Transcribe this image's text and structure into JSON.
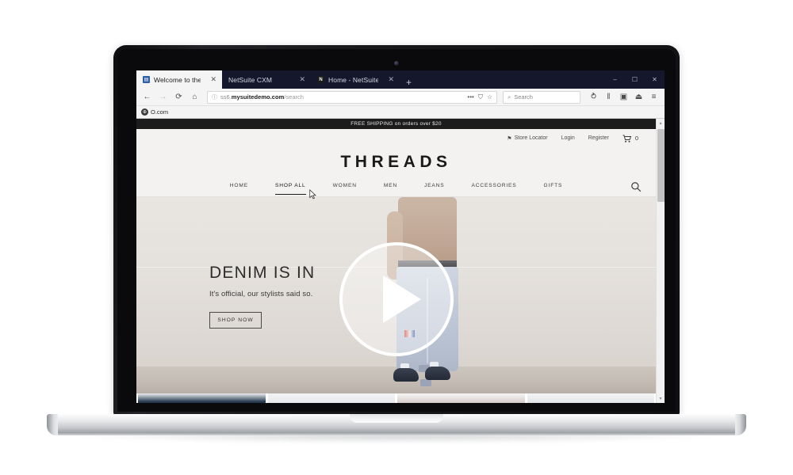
{
  "browser": {
    "tabs": [
      {
        "title": "Welcome to the store",
        "favicon": "store-favicon",
        "favicon_glyph": "▤",
        "active": true,
        "close": "✕"
      },
      {
        "title": "NetSuite CXM",
        "favicon": "netsuite-favicon",
        "favicon_glyph": "",
        "active": false,
        "close": "✕"
      },
      {
        "title": "Home - NetSuite (SuiteSucces",
        "favicon": "netsuite-favicon",
        "favicon_glyph": "N",
        "active": false,
        "close": "✕"
      }
    ],
    "new_tab_label": "+",
    "window_controls": {
      "minimize": "–",
      "maximize": "☐",
      "close": "✕"
    },
    "nav": {
      "back": "←",
      "forward": "→",
      "reload": "⟳",
      "home": "⌂"
    },
    "url": {
      "security_glyph": "ⓘ",
      "subdomain": "ss6.",
      "domain": "mysuitedemo.com",
      "path": "/search",
      "page_actions": "•••",
      "tracking_shield": "⛉",
      "bookmark_star": "☆"
    },
    "search": {
      "placeholder": "Search",
      "icon": "search-icon",
      "glyph": "⌕"
    },
    "toolbar_icons": [
      {
        "name": "pocket-icon",
        "glyph": "⥁"
      },
      {
        "name": "library-icon",
        "glyph": "‖"
      },
      {
        "name": "sidebar-icon",
        "glyph": "▣"
      },
      {
        "name": "save-page-icon",
        "glyph": "⏏"
      },
      {
        "name": "app-menu-icon",
        "glyph": "≡"
      }
    ],
    "bookmarks": [
      {
        "label": "O.com",
        "icon_glyph": "⊕"
      }
    ]
  },
  "site": {
    "promo_banner": "FREE SHIPPING on orders over $20",
    "utility": {
      "store_locator": "Store Locator",
      "store_locator_icon": "⌘",
      "pin_glyph": "⚑",
      "login": "Login",
      "register": "Register",
      "cart_icon": "cart-icon",
      "cart_count": "0"
    },
    "brand": "THREADS",
    "nav_items": [
      {
        "label": "HOME",
        "active": false
      },
      {
        "label": "SHOP ALL",
        "active": true
      },
      {
        "label": "WOMEN",
        "active": false
      },
      {
        "label": "MEN",
        "active": false
      },
      {
        "label": "JEANS",
        "active": false
      },
      {
        "label": "ACCESSORIES",
        "active": false
      },
      {
        "label": "GIFTS",
        "active": false
      }
    ],
    "nav_search_icon": "search-icon",
    "hero": {
      "title": "DENIM IS IN",
      "subtitle": "It's official, our stylists said so.",
      "cta": "SHOP NOW",
      "play_button": "play-button",
      "background_color": "#e4e0dc"
    },
    "product_tiles": [
      {
        "name": "product-tile-1"
      },
      {
        "name": "product-tile-2"
      },
      {
        "name": "product-tile-3"
      },
      {
        "name": "product-tile-4"
      }
    ],
    "scrollbar": {
      "up": "▴",
      "down": "▾"
    }
  },
  "colors": {
    "tabstrip": "#15182c",
    "promo_bar": "#1c1c1c",
    "page_bg": "#f3f2f0",
    "hero_bg": "#e4e0dc",
    "accent": "#1c1c1c"
  }
}
